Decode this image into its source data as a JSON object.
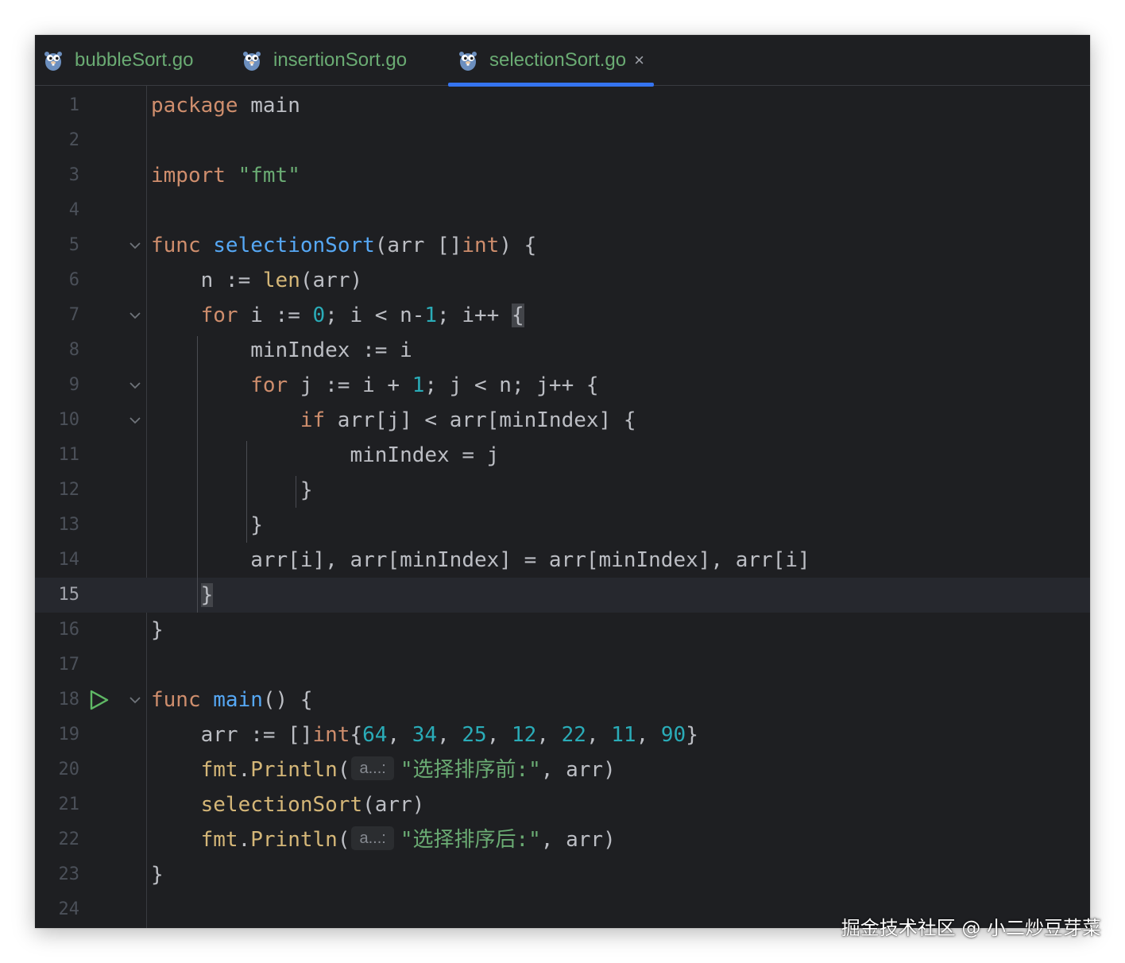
{
  "tabs": [
    {
      "label": "bubbleSort.go",
      "icon": "gopher-icon"
    },
    {
      "label": "insertionSort.go",
      "icon": "gopher-icon"
    },
    {
      "label": "selectionSort.go",
      "icon": "gopher-icon",
      "active": true,
      "close": "×"
    }
  ],
  "editor": {
    "current_line": 15,
    "line_numbers": [
      "1",
      "2",
      "3",
      "4",
      "5",
      "6",
      "7",
      "8",
      "9",
      "10",
      "11",
      "12",
      "13",
      "14",
      "15",
      "16",
      "17",
      "18",
      "19",
      "20",
      "21",
      "22",
      "23",
      "24"
    ],
    "lines": [
      {
        "t": [
          [
            "kw",
            "package"
          ],
          [
            "",
            "main"
          ]
        ]
      },
      {
        "t": []
      },
      {
        "t": [
          [
            "kw",
            "import"
          ],
          [
            "",
            ""
          ],
          [
            "str",
            "\"fmt\""
          ]
        ]
      },
      {
        "t": []
      },
      {
        "t": [
          [
            "kw",
            "func"
          ],
          [
            "",
            ""
          ],
          [
            "fnd",
            "selectionSort"
          ],
          [
            "",
            "(arr []"
          ],
          [
            "kw",
            "int"
          ],
          [
            "",
            ") {"
          ]
        ]
      },
      {
        "t": [
          [
            "",
            "    n := "
          ],
          [
            "call",
            "len"
          ],
          [
            "",
            "(arr)"
          ]
        ]
      },
      {
        "t": [
          [
            "kw",
            "    for"
          ],
          [
            "",
            " i := "
          ],
          [
            "num",
            "0"
          ],
          [
            "",
            "; i < n-"
          ],
          [
            "num",
            "1"
          ],
          [
            "",
            "; i++ "
          ],
          [
            "hl",
            "{"
          ]
        ]
      },
      {
        "t": [
          [
            "",
            "        minIndex := i"
          ]
        ]
      },
      {
        "t": [
          [
            "kw",
            "        for"
          ],
          [
            "",
            " j := i + "
          ],
          [
            "num",
            "1"
          ],
          [
            "",
            "; j < n; j++ {"
          ]
        ]
      },
      {
        "t": [
          [
            "kw",
            "            if"
          ],
          [
            "",
            " arr[j] < arr[minIndex] {"
          ]
        ]
      },
      {
        "t": [
          [
            "",
            "                minIndex = j"
          ]
        ]
      },
      {
        "t": [
          [
            "",
            "            }"
          ]
        ]
      },
      {
        "t": [
          [
            "",
            "        }"
          ]
        ]
      },
      {
        "t": [
          [
            "",
            "        arr[i], arr[minIndex] = arr[minIndex], arr[i]"
          ]
        ]
      },
      {
        "t": [
          [
            "",
            "    "
          ],
          [
            "hl",
            "}"
          ]
        ]
      },
      {
        "t": [
          [
            "",
            "}"
          ]
        ]
      },
      {
        "t": []
      },
      {
        "t": [
          [
            "kw",
            "func"
          ],
          [
            "",
            ""
          ],
          [
            "fnd",
            "main"
          ],
          [
            "",
            "() {"
          ]
        ]
      },
      {
        "t": [
          [
            "",
            "    arr := []"
          ],
          [
            "kw",
            "int"
          ],
          [
            "",
            "{"
          ],
          [
            "num",
            "64"
          ],
          [
            "",
            ", "
          ],
          [
            "num",
            "34"
          ],
          [
            "",
            ", "
          ],
          [
            "num",
            "25"
          ],
          [
            "",
            ", "
          ],
          [
            "num",
            "12"
          ],
          [
            "",
            ", "
          ],
          [
            "num",
            "22"
          ],
          [
            "",
            ", "
          ],
          [
            "num",
            "11"
          ],
          [
            "",
            ", "
          ],
          [
            "num",
            "90"
          ],
          [
            "",
            "}"
          ]
        ]
      },
      {
        "t": [
          [
            "call",
            "    fmt"
          ],
          [
            "",
            "."
          ],
          [
            "call",
            "Println"
          ],
          [
            "",
            "("
          ],
          [
            "hint",
            "a...:"
          ],
          [
            "str",
            "\"选择排序前:\""
          ],
          [
            "",
            ", arr)"
          ]
        ]
      },
      {
        "t": [
          [
            "call",
            "    selectionSort"
          ],
          [
            "",
            "(arr)"
          ]
        ]
      },
      {
        "t": [
          [
            "call",
            "    fmt"
          ],
          [
            "",
            "."
          ],
          [
            "call",
            "Println"
          ],
          [
            "",
            "("
          ],
          [
            "hint",
            "a...:"
          ],
          [
            "str",
            "\"选择排序后:\""
          ],
          [
            "",
            ", arr)"
          ]
        ]
      },
      {
        "t": [
          [
            "",
            "}"
          ]
        ]
      },
      {
        "t": []
      }
    ],
    "fold_lines": [
      5,
      7,
      9,
      10,
      18
    ],
    "run_line": 18
  },
  "colors": {
    "background": "#1e1f22",
    "keyword": "#cf8e6d",
    "function_decl": "#56a8f5",
    "function_call": "#d5b778",
    "number": "#2aacb8",
    "string": "#6aab73",
    "tab_accent": "#3574f0"
  },
  "watermark": "掘金技术社区 @ 小二炒豆芽菜"
}
